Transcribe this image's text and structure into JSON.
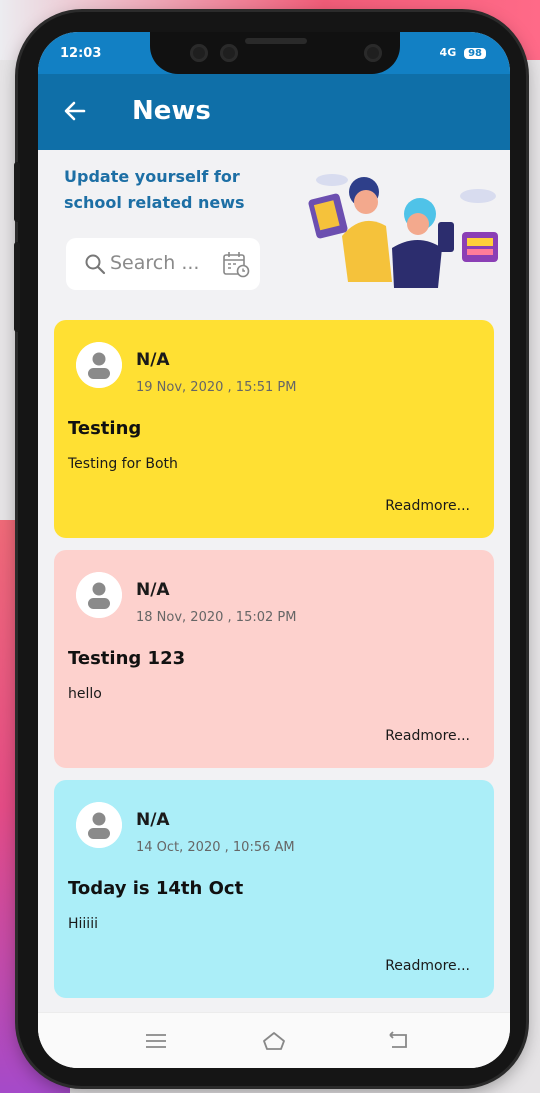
{
  "status_bar": {
    "time": "12:03",
    "network": "4G",
    "battery": "98"
  },
  "app_bar": {
    "title": "News"
  },
  "hero": {
    "tagline": "Update yourself for school related news",
    "search_placeholder": "Search ..."
  },
  "news": [
    {
      "author": "N/A",
      "date": "19 Nov, 2020 , 15:51 PM",
      "title": "Testing",
      "body": "Testing for Both",
      "readmore": "Readmore...",
      "color": "#ffe033"
    },
    {
      "author": "N/A",
      "date": "18 Nov, 2020 , 15:02 PM",
      "title": "Testing 123",
      "body": "hello",
      "readmore": "Readmore...",
      "color": "#fdd1cd"
    },
    {
      "author": "N/A",
      "date": "14 Oct, 2020 , 10:56 AM",
      "title": "Today is 14th Oct",
      "body": "Hiiiii",
      "readmore": "Readmore...",
      "color": "#abeef8"
    }
  ],
  "icons": {
    "back": "arrow-left-icon",
    "search": "search-icon",
    "calendar": "calendar-icon",
    "avatar": "user-avatar-icon",
    "nav": [
      "menu-icon",
      "home-icon",
      "back-nav-icon"
    ]
  },
  "colors": {
    "primary": "#0f6fa8",
    "status": "#1280c4",
    "tagline": "#1d6fa5"
  }
}
